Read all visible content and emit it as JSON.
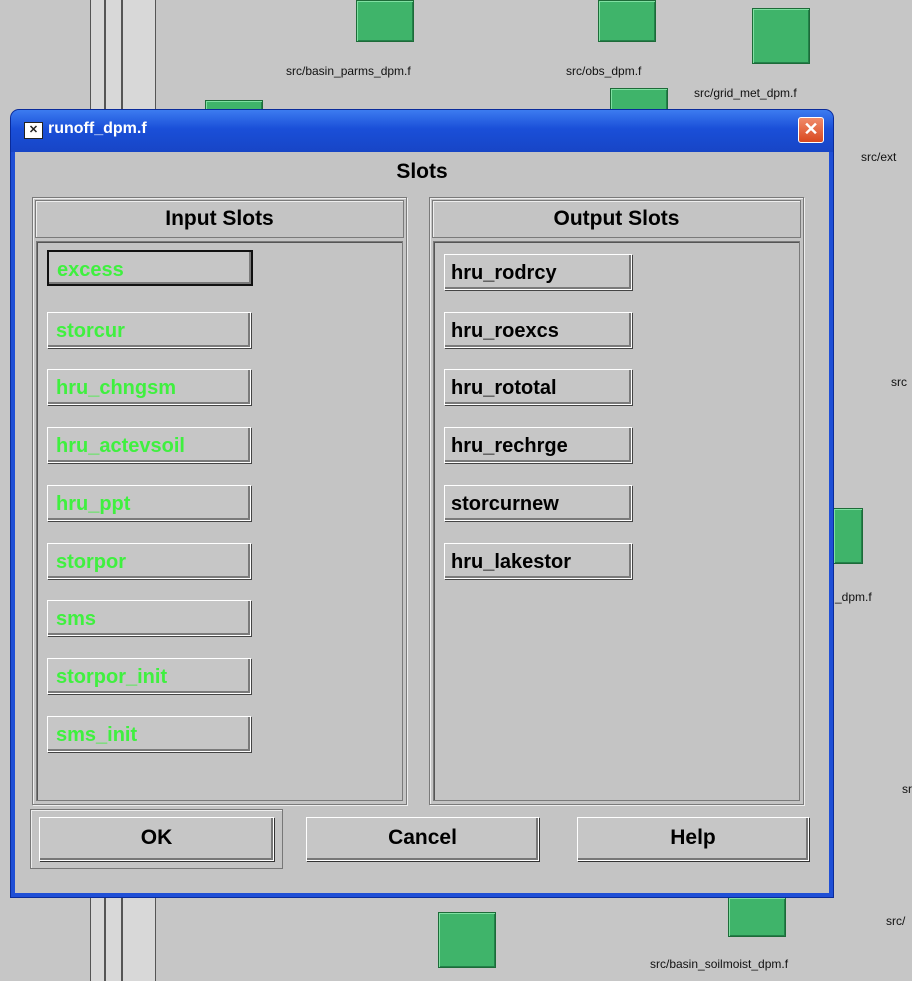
{
  "background": {
    "labels": {
      "basin_parms": "src/basin_parms_dpm.f",
      "obs": "src/obs_dpm.f",
      "grid_met": "src/grid_met_dpm.f",
      "ext": "src/ext",
      "src_r1": "src",
      "dpm": "_dpm.f",
      "sr": "sr",
      "src_r2": "src/",
      "basin_soilmoist": "src/basin_soilmoist_dpm.f"
    },
    "node_color": "#3fb46a"
  },
  "dialog": {
    "icon_glyph": "✕",
    "title": "runoff_dpm.f",
    "close_glyph": "✕",
    "section_title": "Slots",
    "input_panel": {
      "header": "Input Slots",
      "slots": [
        "excess",
        "storcur",
        "hru_chngsm",
        "hru_actevsoil",
        "hru_ppt",
        "storpor",
        "sms",
        "storpor_init",
        "sms_init"
      ]
    },
    "output_panel": {
      "header": "Output Slots",
      "slots": [
        "hru_rodrcy",
        "hru_roexcs",
        "hru_rototal",
        "hru_rechrge",
        "storcurnew",
        "hru_lakestor"
      ]
    },
    "buttons": {
      "ok": "OK",
      "cancel": "Cancel",
      "help": "Help"
    },
    "colors": {
      "titlebar": "#1a4fd8",
      "input_slot_text": "#3ff03f",
      "output_slot_text": "#000000"
    }
  }
}
